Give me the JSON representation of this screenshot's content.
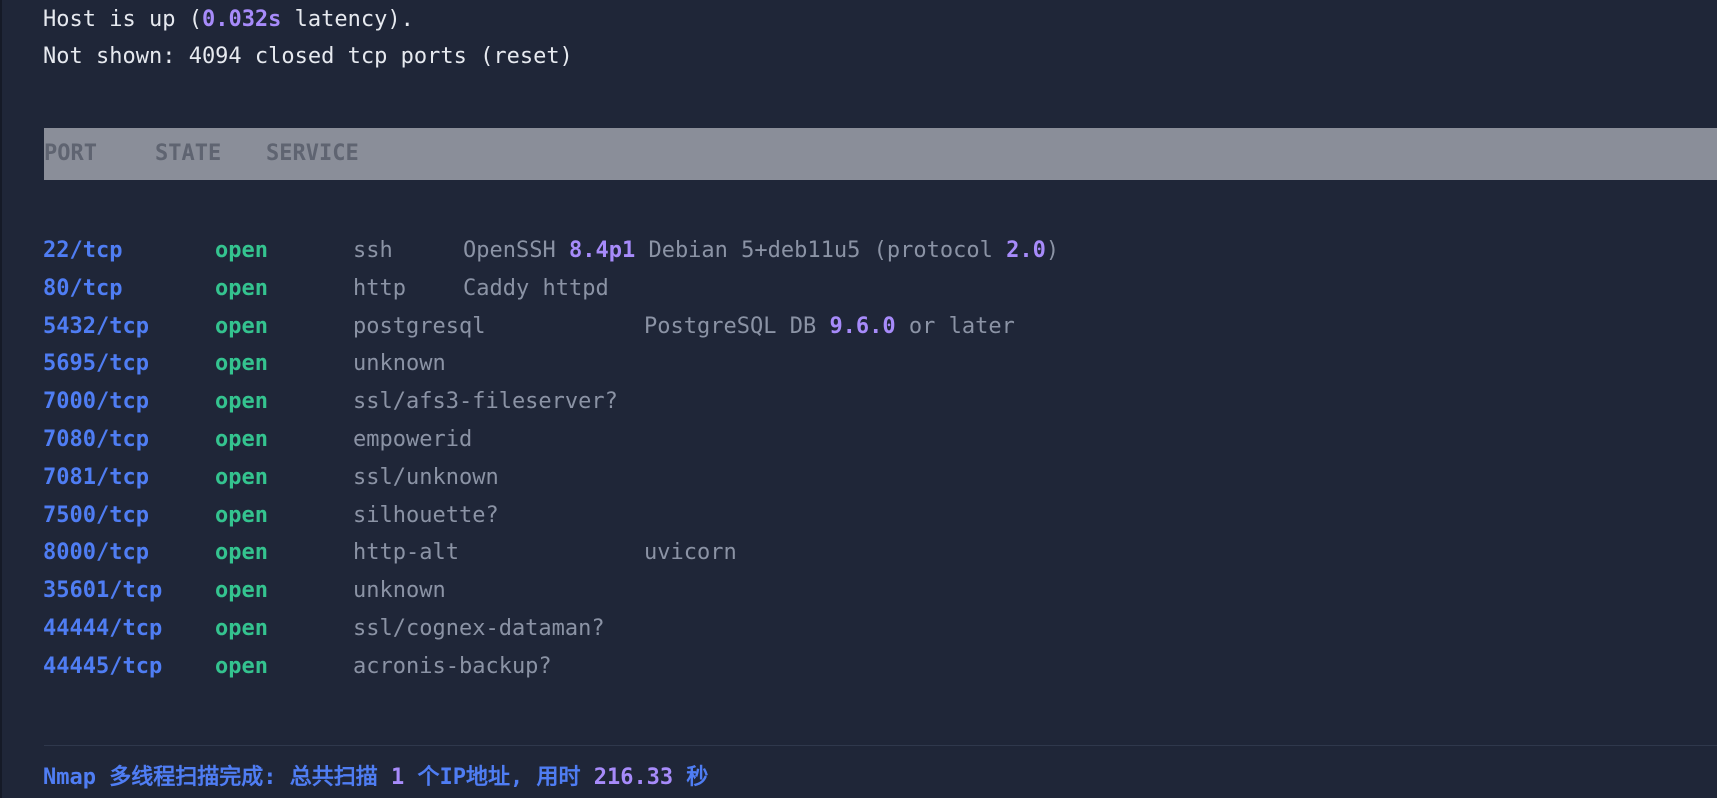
{
  "summary": {
    "host_prefix": "Host is up (",
    "latency": "0.032s",
    "host_suffix": " latency).",
    "not_shown": "Not shown: 4094 closed tcp ports (reset)"
  },
  "table": {
    "headers": [
      "PORT",
      "STATE",
      "SERVICE"
    ],
    "rows": [
      {
        "port": "22/tcp",
        "state": "open",
        "service": "ssh",
        "version_parts": [
          {
            "t": "OpenSSH ",
            "v": false
          },
          {
            "t": "8.4p1",
            "v": true
          },
          {
            "t": " Debian 5+deb11u5 (protocol ",
            "v": false
          },
          {
            "t": "2.0",
            "v": true
          },
          {
            "t": ")",
            "v": false
          }
        ]
      },
      {
        "port": "80/tcp",
        "state": "open",
        "service": "http",
        "version_parts": [
          {
            "t": "Caddy httpd",
            "v": false
          }
        ]
      },
      {
        "port": "5432/tcp",
        "state": "open",
        "service": "postgresql",
        "version_parts": [
          {
            "t": "PostgreSQL DB ",
            "v": false
          },
          {
            "t": "9.6.0",
            "v": true
          },
          {
            "t": " or later",
            "v": false
          }
        ]
      },
      {
        "port": "5695/tcp",
        "state": "open",
        "service": "unknown",
        "version_parts": []
      },
      {
        "port": "7000/tcp",
        "state": "open",
        "service": "ssl/afs3-fileserver?",
        "version_parts": []
      },
      {
        "port": "7080/tcp",
        "state": "open",
        "service": "empowerid",
        "version_parts": []
      },
      {
        "port": "7081/tcp",
        "state": "open",
        "service": "ssl/unknown",
        "version_parts": []
      },
      {
        "port": "7500/tcp",
        "state": "open",
        "service": "silhouette?",
        "version_parts": []
      },
      {
        "port": "8000/tcp",
        "state": "open",
        "service": "http-alt",
        "version_parts": [
          {
            "t": "uvicorn",
            "v": false
          }
        ]
      },
      {
        "port": "35601/tcp",
        "state": "open",
        "service": "unknown",
        "version_parts": []
      },
      {
        "port": "44444/tcp",
        "state": "open",
        "service": "ssl/cognex-dataman?",
        "version_parts": []
      },
      {
        "port": "44445/tcp",
        "state": "open",
        "service": "acronis-backup?",
        "version_parts": []
      }
    ]
  },
  "footer": {
    "prefix": "Nmap 多线程扫描完成: 总共扫描 ",
    "count": "1",
    "middle": " 个IP地址, 用时 ",
    "duration": "216.33",
    "suffix": " 秒"
  },
  "colors": {
    "background": "#1f2638",
    "port": "#4f7df3",
    "state_open": "#34c38f",
    "number_highlight": "#a78bfa",
    "muted_text": "#8b93a5",
    "header_bar": "#8a8e99"
  }
}
